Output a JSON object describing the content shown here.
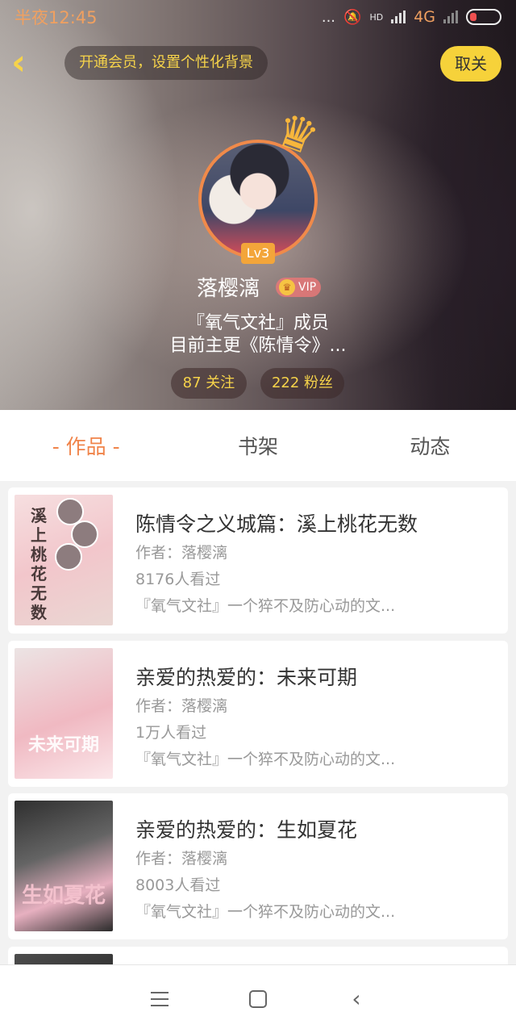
{
  "status": {
    "time": "半夜12:45",
    "dots": "...",
    "hd": "HD",
    "network": "4G"
  },
  "header": {
    "member_tip": "开通会员，设置个性化背景",
    "cancel_label": "取关",
    "level": "Lv3",
    "username": "落樱漓",
    "vip_label": "VIP",
    "bio_line1": "『氧气文社』成员",
    "bio_line2": "目前主更《陈情令》...",
    "following": "87 关注",
    "followers": "222 粉丝"
  },
  "tabs": [
    {
      "label": "- 作品 -",
      "active": true
    },
    {
      "label": "书架",
      "active": false
    },
    {
      "label": "动态",
      "active": false
    }
  ],
  "books": [
    {
      "title": "陈情令之义城篇：溪上桃花无数",
      "author": "作者：落樱漓",
      "views": "8176人看过",
      "desc": "『氧气文社』一个猝不及防心动的文...",
      "cover_text": "溪上桃花无数"
    },
    {
      "title": "亲爱的热爱的：未来可期",
      "author": "作者：落樱漓",
      "views": "1万人看过",
      "desc": "『氧气文社』一个猝不及防心动的文...",
      "cover_text": "未来可期"
    },
    {
      "title": "亲爱的热爱的：生如夏花",
      "author": "作者：落樱漓",
      "views": "8003人看过",
      "desc": "『氧气文社』一个猝不及防心动的文...",
      "cover_text": "生如夏花"
    }
  ],
  "colors": {
    "accent": "#f0844a",
    "yellow": "#f6d23a",
    "badge": "#f3a53a"
  },
  "icons": {
    "back": "chevron-left-icon",
    "crown": "crown-icon",
    "nav": [
      "menu-icon",
      "home-icon",
      "back-icon"
    ]
  }
}
